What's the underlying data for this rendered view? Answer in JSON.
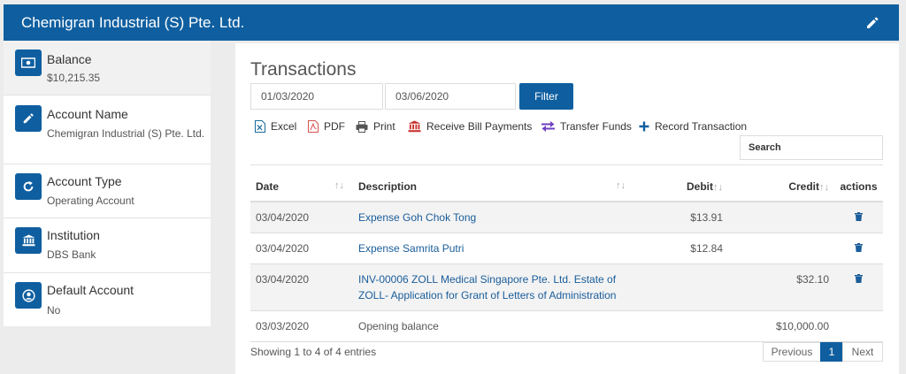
{
  "header": {
    "title": "Chemigran Industrial (S) Pte. Ltd."
  },
  "sidebar": {
    "items": [
      {
        "label": "Balance",
        "value": "$10,215.35",
        "icon": "money-icon"
      },
      {
        "label": "Account Name",
        "value": "Chemigran Industrial (S) Pte. Ltd.",
        "icon": "pencil-icon"
      },
      {
        "label": "Account Type",
        "value": "Operating Account",
        "icon": "refresh-icon"
      },
      {
        "label": "Institution",
        "value": "DBS Bank",
        "icon": "bank-icon"
      },
      {
        "label": "Default Account",
        "value": "No",
        "icon": "user-circle-icon"
      }
    ]
  },
  "main": {
    "title": "Transactions",
    "date_from": "01/03/2020",
    "date_to": "03/06/2020",
    "filter_label": "Filter",
    "toolbar": {
      "excel": "Excel",
      "pdf": "PDF",
      "print": "Print",
      "receive": "Receive Bill Payments",
      "transfer": "Transfer Funds",
      "record": "Record Transaction"
    },
    "search_placeholder": "Search",
    "columns": {
      "date": "Date",
      "description": "Description",
      "debit": "Debit",
      "credit": "Credit",
      "actions": "actions"
    },
    "rows": [
      {
        "date": "03/04/2020",
        "description": "Expense Goh Chok Tong",
        "debit": "$13.91",
        "credit": ""
      },
      {
        "date": "03/04/2020",
        "description": "Expense Samrita Putri",
        "debit": "$12.84",
        "credit": ""
      },
      {
        "date": "03/04/2020",
        "description": "INV-00006 ZOLL Medical Singapore Pte. Ltd. Estate of ZOLL- Application for Grant of Letters of Administration",
        "debit": "",
        "credit": "$32.10"
      },
      {
        "date": "03/03/2020",
        "description": "Opening balance",
        "debit": "",
        "credit": "$10,000.00"
      }
    ],
    "footer": {
      "showing": "Showing 1 to 4 of 4 entries",
      "previous": "Previous",
      "page": "1",
      "next": "Next"
    }
  }
}
